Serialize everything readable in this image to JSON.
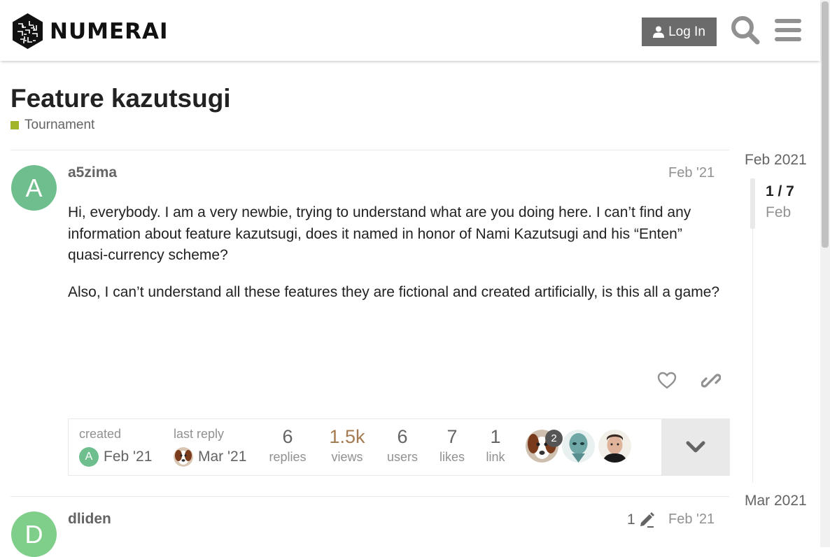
{
  "header": {
    "brand": "NUMERAI",
    "login_label": "Log In"
  },
  "topic": {
    "title": "Feature kazutsugi",
    "category": "Tournament",
    "category_color": "#a2b528"
  },
  "post1": {
    "avatar_letter": "A",
    "avatar_color": "#6fbf8e",
    "username": "a5zima",
    "date": "Feb '21",
    "paragraphs": [
      "Hi, everybody. I am a very newbie, trying to understand what are you doing here. I can’t find any information about feature kazutsugi, does it named in honor of Nami Kazutsugi and his “Enten” quasi-currency scheme?",
      "Also, I can’t understand all these features they are fictional and created artificially, is this all a game?"
    ]
  },
  "summary": {
    "created_label": "created",
    "created_date": "Feb '21",
    "last_reply_label": "last reply",
    "last_reply_date": "Mar '21",
    "replies_num": "6",
    "replies_label": "replies",
    "views_num": "1.5k",
    "views_label": "views",
    "users_num": "6",
    "users_label": "users",
    "likes_num": "7",
    "likes_label": "likes",
    "links_num": "1",
    "links_label": "link",
    "participant_badge": "2"
  },
  "timeline": {
    "top_date": "Feb 2021",
    "position": "1 / 7",
    "month": "Feb",
    "bottom_date": "Mar 2021"
  },
  "post2": {
    "avatar_letter": "D",
    "avatar_color": "#7fcf8a",
    "username": "dliden",
    "edit_count": "1",
    "date": "Feb '21"
  }
}
